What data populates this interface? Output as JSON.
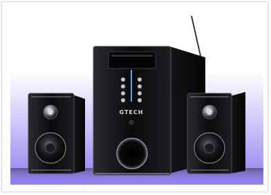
{
  "product": {
    "brand_logo": "GTECH",
    "colors": {
      "backdrop_top": "#ffffff",
      "backdrop_bottom": "#8f7ff0",
      "cabinet": "#0d0d0f",
      "trim": "#8a8a92",
      "button_glow": "#6fb7ff"
    }
  }
}
